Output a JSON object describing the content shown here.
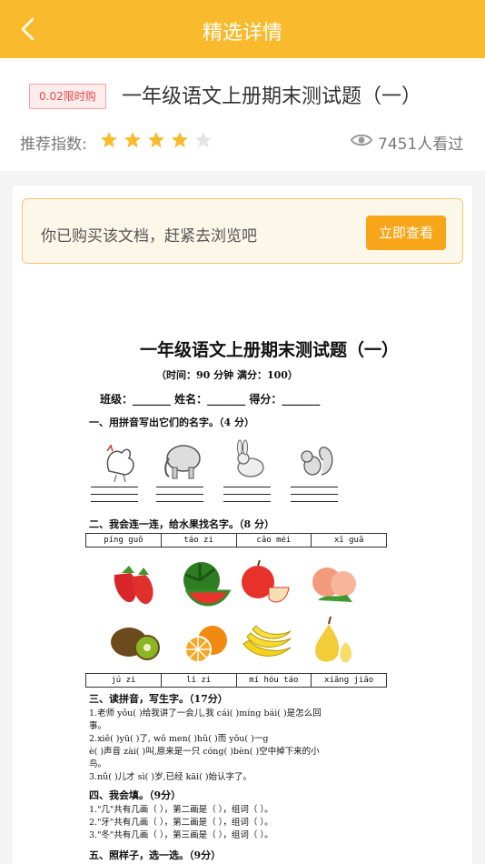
{
  "header": {
    "title": "精选详情",
    "back_icon": "chevron-left-icon"
  },
  "doc": {
    "badge": "0.02限时购",
    "title": "一年级语文上册期末测试题（一）",
    "rating_label": "推荐指数:",
    "rating": 4,
    "rating_max": 5,
    "views": "7451人看过"
  },
  "banner": {
    "text": "你已购买该文档，赶紧去浏览吧",
    "button": "立即查看"
  },
  "paper": {
    "title": "一年级语文上册期末测试题（一）",
    "time": "（时间：90 分钟  满分：100）",
    "row": "班级：_______    姓名：_______    得分：_______",
    "sec1": "一、用拼音写出它们的名字。（4 分）",
    "sec2": "二、我会连一连，给水果找名字。（8 分）",
    "pinyin_top": [
      "píng  guǒ",
      "táo  zi",
      "cǎo  méi",
      "xī guā"
    ],
    "pinyin_bottom": [
      "jú  zi",
      "lí  zi",
      "mí hóu táo",
      "xiāng  jiāo"
    ],
    "sec3": "三、读拼音，写生字。（17分）",
    "l1": "1.老师 yǒu(    )给我讲了一会儿,我 cái(    )míng    bái(    )是怎么回",
    "l1b": "事。",
    "l2": "2.xiě(    )yū(    )了, wǒ   men(    )hǔ(    )而 yǒu(    )一g",
    "l2b": "è(    )声音 zài(    )叫,原来是一只 cóng(    )bèn(    )空中掉下来的小",
    "l2c": "鸟。",
    "l3": "3.nǚ(    )儿才 sì(    )岁,已经 kāi(    )始认字了。",
    "sec4": "四、我会填。（9分）",
    "f1": "1.\"几\"共有几画（     ），第二画是（     ），组词（     ）。",
    "f2": "2.\"牙\"共有几画（     ），第二画是（     ），组词（     ）。",
    "f3": "3.\"冬\"共有几画（     ），第三画是（     ），组词（     ）。",
    "sec5": "五、照样子，选一选。（9分）"
  },
  "colors": {
    "accent": "#f9bb2d",
    "button": "#f8a619",
    "star_on": "#f9bb2d",
    "star_off": "#e4e4e4"
  }
}
